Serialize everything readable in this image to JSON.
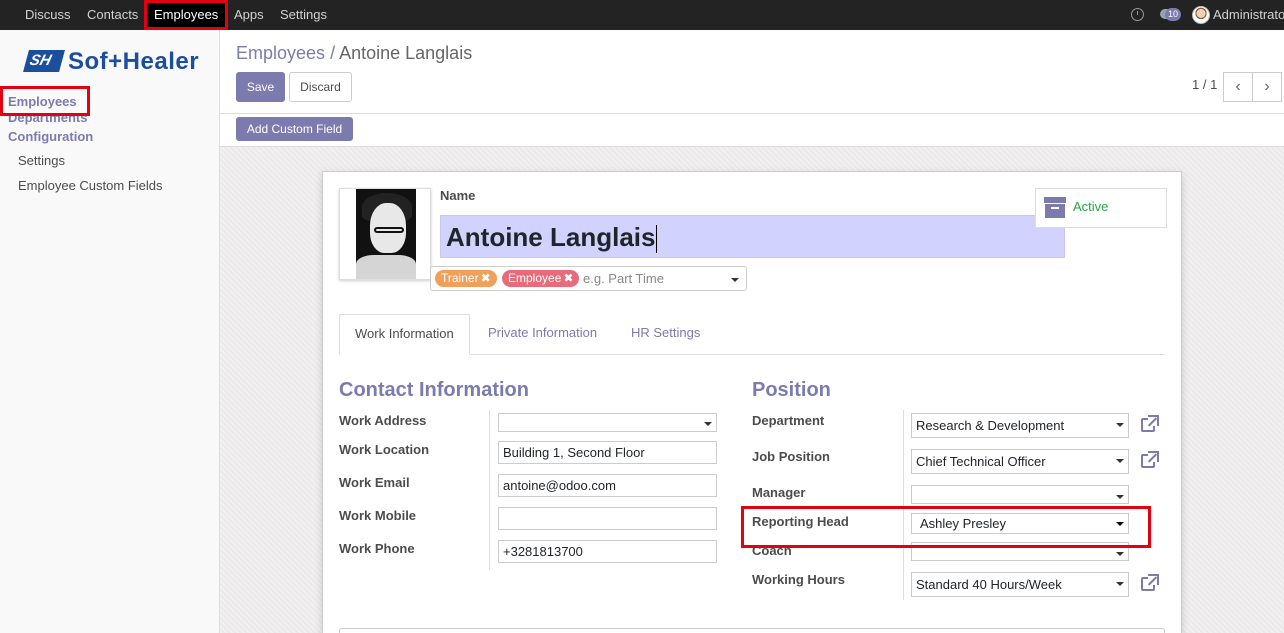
{
  "topbar": {
    "menu": [
      "Discuss",
      "Contacts",
      "Employees",
      "Apps",
      "Settings"
    ],
    "active": "Employees",
    "message_count": "10",
    "user": "Administrator"
  },
  "sidebar": {
    "logo_text": "Sof+Healer",
    "logo_mark": "SH",
    "items": [
      "Employees",
      "Departments",
      "Configuration"
    ],
    "sub_items": [
      "Settings",
      "Employee Custom Fields"
    ]
  },
  "control": {
    "breadcrumb_parent": "Employees",
    "breadcrumb_sep": "/",
    "breadcrumb_current": "Antoine Langlais",
    "save_label": "Save",
    "discard_label": "Discard",
    "pager": "1 / 1",
    "add_custom_field_label": "Add Custom Field"
  },
  "form": {
    "name_label": "Name",
    "name_value": "Antoine Langlais",
    "tags": [
      "Trainer",
      "Employee"
    ],
    "tag_colors": [
      "#f0a05a",
      "#e96b7b"
    ],
    "tags_placeholder": "e.g. Part Time",
    "status": "Active",
    "tabs": [
      "Work Information",
      "Private Information",
      "HR Settings"
    ],
    "contact": {
      "title": "Contact Information",
      "work_address_label": "Work Address",
      "work_address_value": "",
      "work_location_label": "Work Location",
      "work_location_value": "Building 1, Second Floor",
      "work_email_label": "Work Email",
      "work_email_value": "antoine@odoo.com",
      "work_mobile_label": "Work Mobile",
      "work_mobile_value": "",
      "work_phone_label": "Work Phone",
      "work_phone_value": "+3281813700"
    },
    "position": {
      "title": "Position",
      "department_label": "Department",
      "department_value": "Research & Development",
      "job_position_label": "Job Position",
      "job_position_value": "Chief Technical Officer",
      "manager_label": "Manager",
      "manager_value": "",
      "reporting_head_label": "Reporting Head",
      "reporting_head_value": "Ashley Presley",
      "coach_label": "Coach",
      "coach_value": "",
      "working_hours_label": "Working Hours",
      "working_hours_value": "Standard 40 Hours/Week"
    }
  },
  "colors": {
    "accent": "#7c7bad",
    "highlight": "#e3000f",
    "status_active": "#28a745"
  }
}
